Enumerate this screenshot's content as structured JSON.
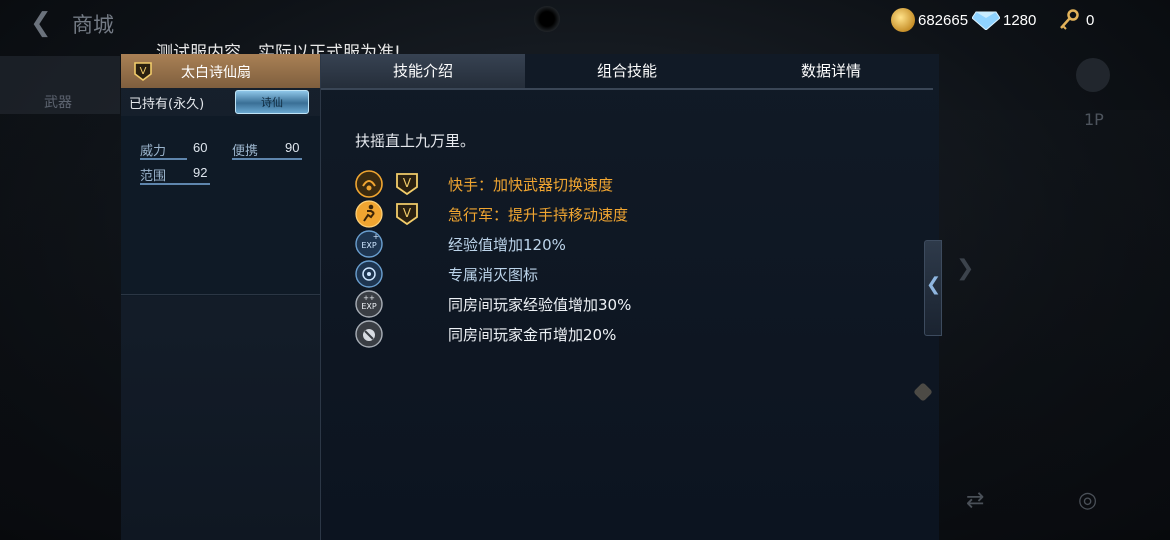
{
  "topbar": {
    "title": "商城",
    "coins": "682665",
    "gems": "1280",
    "keys": "0"
  },
  "notice": "测试服内容，实际以正式服为准!",
  "sidebar": {
    "category_label": "武器"
  },
  "item": {
    "name": "太白诗仙扇",
    "ownership": "已持有(永久)",
    "tag": "诗仙",
    "stats": [
      {
        "label": "威力",
        "value": "60"
      },
      {
        "label": "便携",
        "value": "90"
      },
      {
        "label": "范围",
        "value": "92"
      }
    ]
  },
  "tabs": [
    {
      "label": "技能介绍",
      "active": true
    },
    {
      "label": "组合技能",
      "active": false
    },
    {
      "label": "数据详情",
      "active": false
    }
  ],
  "description": "扶摇直上九万里。",
  "skills": [
    {
      "icon": "quick-hand-icon",
      "vip": true,
      "text": "快手：加快武器切换速度",
      "color": "#f0a531"
    },
    {
      "icon": "sprint-icon",
      "vip": true,
      "text": "急行军：提升手持移动速度",
      "color": "#f0a531"
    },
    {
      "icon": "exp-icon",
      "vip": false,
      "text": "经验值增加120%",
      "color": "#bcd4ea"
    },
    {
      "icon": "kill-mark-icon",
      "vip": false,
      "text": "专属消灭图标",
      "color": "#bcd4ea"
    },
    {
      "icon": "room-exp-icon",
      "vip": false,
      "text": "同房间玩家经验值增加30%",
      "color": "#eef2f6"
    },
    {
      "icon": "room-gold-icon",
      "vip": false,
      "text": "同房间玩家金币增加20%",
      "color": "#eef2f6"
    }
  ],
  "right_ghost": {
    "label": "1P"
  }
}
